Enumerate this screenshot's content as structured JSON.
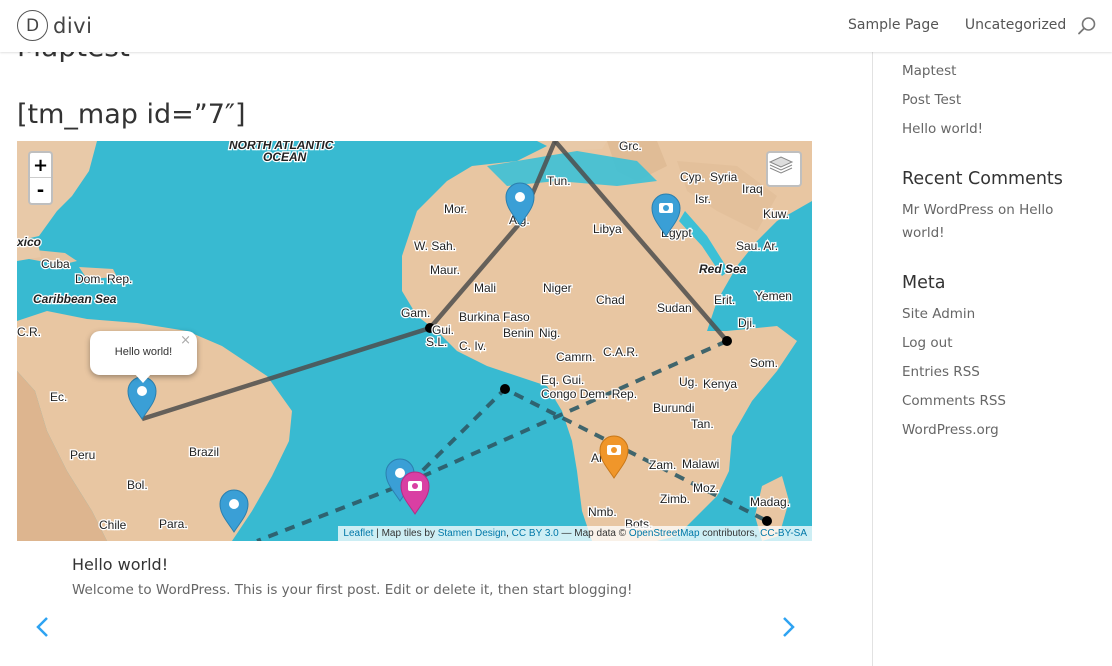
{
  "header": {
    "logo_letter": "D",
    "logo_text": "divi",
    "nav": [
      "Sample Page",
      "Uncategorized"
    ]
  },
  "main": {
    "page_title": "Maptest",
    "shortcode": "[tm_map id=”7″]",
    "slide_title": "Hello world!",
    "slide_text": "Welcome to WordPress. This is your first post. Edit or delete it, then start blogging!"
  },
  "map": {
    "zoom_in": "+",
    "zoom_out": "-",
    "popup_text": "Hello world!",
    "popup_close": "×",
    "attribution": {
      "leaflet": "Leaflet",
      "sep1": " | Map tiles by ",
      "stamen": "Stamen Design",
      "comma": ", ",
      "ccby": "CC BY 3.0",
      "mid": " — Map data © ",
      "osm": "OpenStreetMap",
      "contrib": " contributors, ",
      "ccbysa": "CC-BY-SA"
    },
    "labels": {
      "north_atlantic": "NORTH ATLANTIC",
      "ocean": "OCEAN",
      "caribbean": "Caribbean Sea",
      "red_sea": "Red Sea",
      "cuba": "Cuba",
      "dom_rep": "Dom. Rep.",
      "mexico": "xico",
      "cr": "C.R.",
      "ec": "Ec.",
      "peru": "Peru",
      "brazil": "Brazil",
      "bol": "Bol.",
      "chile": "Chile",
      "para": "Para.",
      "mor": "Mor.",
      "alg": "Alg.",
      "tun": "Tun.",
      "libya": "Libya",
      "egypt": "Egypt",
      "grc": "Grc.",
      "cyp": "Cyp.",
      "syria": "Syria",
      "iraq": "Iraq",
      "isr": "Isr.",
      "kuw": "Kuw.",
      "sau_ar": "Sau. Ar.",
      "yemen": "Yemen",
      "w_sah": "W. Sah.",
      "maur": "Maur.",
      "mali": "Mali",
      "niger": "Niger",
      "chad": "Chad",
      "sudan": "Sudan",
      "erit": "Erit.",
      "dji": "Dji.",
      "eth": "Eth.",
      "som": "Som.",
      "gam": "Gam.",
      "gui": "Gui.",
      "sl": "S.L.",
      "burkina": "Burkina Faso",
      "benin": "Benin",
      "nig": "Nig.",
      "civ": "C. Iv.",
      "camrn": "Camrn.",
      "car": "C.A.R.",
      "eq_gui": "Eq. Gui.",
      "congo": "Congo Dem. Rep.",
      "ug": "Ug.",
      "kenya": "Kenya",
      "burundi": "Burundi",
      "tan": "Tan.",
      "ang": "An",
      "zam": "Zam.",
      "malawi": "Malawi",
      "zimb": "Zimb.",
      "moz": "Moz.",
      "madag": "Madag.",
      "nmb": "Nmb.",
      "bots": "Bots."
    }
  },
  "sidebar": {
    "recent_posts": [
      "Maptest",
      "Post Test",
      "Hello world!"
    ],
    "recent_comments_heading": "Recent Comments",
    "comment_author": "Mr WordPress",
    "comment_on": " on ",
    "comment_post": "Hello world!",
    "meta_heading": "Meta",
    "meta_links": [
      "Site Admin",
      "Log out",
      "Entries RSS",
      "Comments RSS",
      "WordPress.org"
    ]
  },
  "colors": {
    "ocean": "#3cc0d6",
    "land": "#e8c9a8",
    "marker_blue": "#3a9fd6",
    "marker_orange": "#f0962a",
    "marker_pink": "#d93fa3",
    "line": "#4d4d4d",
    "dashed": "#2e5a66",
    "link_blue": "#2ea3f2"
  }
}
